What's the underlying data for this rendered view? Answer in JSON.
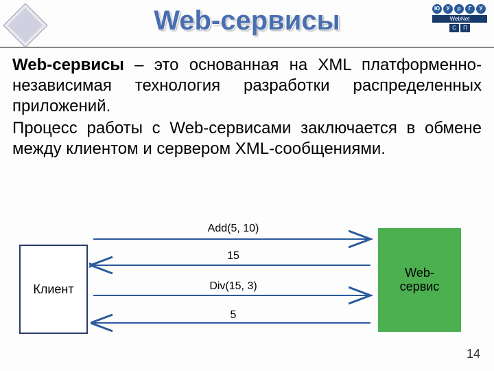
{
  "header": {
    "title": "Web-сервисы"
  },
  "logo_right": {
    "letters": [
      "Ю",
      "У",
      "р",
      "Г",
      "У"
    ],
    "bar": "WebNet",
    "sq1": "С",
    "sq2": "П"
  },
  "body": {
    "term": "Web-сервисы",
    "p1_rest": " – это основанная на XML платформенно-независимая технология разработки распределенных приложений.",
    "p2": "Процесс работы с Web-сервисами заключается в обмене между клиентом и сервером XML-сообщениями."
  },
  "diagram": {
    "client": "Клиент",
    "server": "Web-\nсервис",
    "msg1": "Add(5, 10)",
    "msg2": "15",
    "msg3": "Div(15, 3)",
    "msg4": "5"
  },
  "page": "14"
}
